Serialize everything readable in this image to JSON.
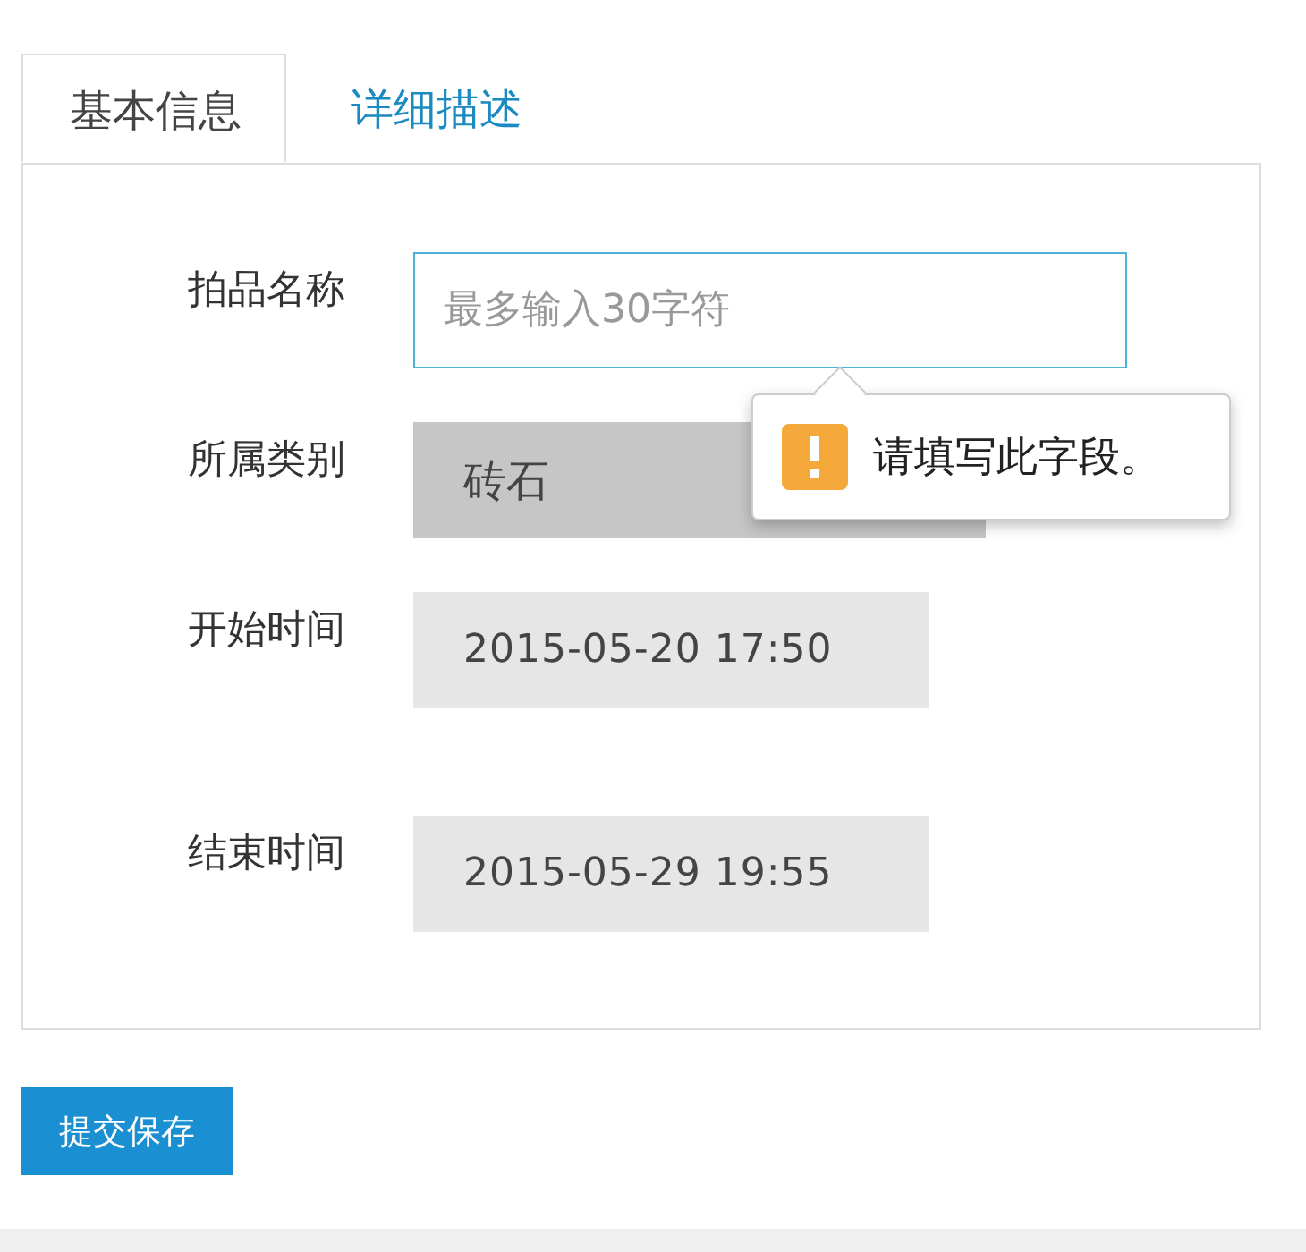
{
  "tabs": [
    {
      "label": "基本信息",
      "selected": true
    },
    {
      "label": "详细描述",
      "selected": false
    }
  ],
  "fields": [
    {
      "label": "拍品名称",
      "kind": "text",
      "placeholder": "最多输入30字符"
    },
    {
      "label": "所属类别",
      "kind": "select",
      "value": "砖石"
    },
    {
      "label": "开始时间",
      "kind": "datetime",
      "value": "2015-05-20 17:50"
    },
    {
      "label": "结束时间",
      "kind": "datetime",
      "value": "2015-05-29 19:55"
    }
  ],
  "validation_tooltip": {
    "message": "请填写此字段。"
  },
  "submit_button": "提交保存"
}
